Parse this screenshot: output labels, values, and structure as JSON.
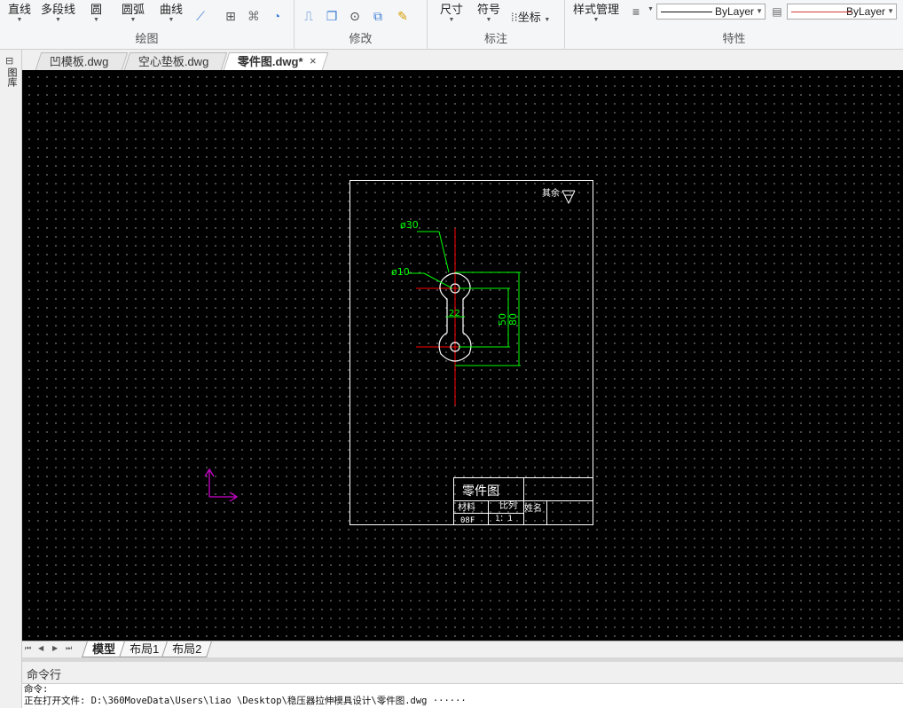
{
  "ribbon": {
    "draw": {
      "line": "直线",
      "polyline": "多段线",
      "circle": "圆",
      "arc": "圆弧",
      "curve": "曲线",
      "title": "绘图"
    },
    "modify": {
      "title": "修改"
    },
    "annotate": {
      "dimension": "尺寸",
      "symbol": "符号",
      "coordinate": "坐标",
      "title": "标注"
    },
    "properties": {
      "style_manager": "样式管理",
      "linetype_value": "ByLayer",
      "color_value": "ByLayer",
      "title": "特性"
    }
  },
  "palette": {
    "label": "图库"
  },
  "doc_tabs": [
    {
      "label": "凹模板.dwg"
    },
    {
      "label": "空心垫板.dwg"
    },
    {
      "label": "零件图.dwg*"
    }
  ],
  "doc_tab_close": "×",
  "drawing": {
    "roughness_note": "其余",
    "dim_dia30": "ø30",
    "dim_dia10": "ø10",
    "dim_22": "22",
    "dim_50": "50",
    "dim_80": "80",
    "title_block": {
      "name": "零件图",
      "material_label": "材料",
      "scale_label": "比列",
      "name_label": "姓名",
      "material_value": "08F",
      "scale_value": "1：1"
    }
  },
  "layout_tabs": [
    {
      "label": "模型"
    },
    {
      "label": "布局1"
    },
    {
      "label": "布局2"
    }
  ],
  "command": {
    "title": "命令行",
    "line1": "命令:",
    "line2": "正在打开文件: D:\\360MoveData\\Users\\liao \\Desktop\\稳压器拉伸模具设计\\零件图.dwg ······"
  },
  "colors": {
    "canvas_bg": "#000000",
    "drawing_white": "#ffffff",
    "dimension_green": "#00ff00",
    "centerline_red": "#ff0000",
    "ucs_magenta": "#cc00cc",
    "color_line_red": "#d33a3a"
  }
}
